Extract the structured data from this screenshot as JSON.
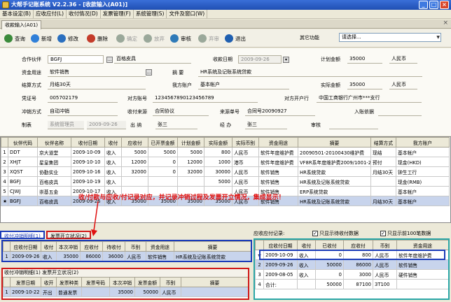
{
  "window": {
    "title": "大帮手记账系统  V2.2.36  - [收款输入(A01)]",
    "min": "_",
    "max": "□",
    "close": "×"
  },
  "menu": [
    "基本设定(B)",
    "应收应付(L)",
    "收付情况(D)",
    "发票管理(F)",
    "系统管理(S)",
    "文件及窗口(W)"
  ],
  "doc_tab": {
    "label": "收款输入(A01)",
    "close": "×"
  },
  "toolbar": {
    "buttons": [
      {
        "label": "查询",
        "color": "#3a8a3a"
      },
      {
        "label": "新增",
        "color": "#2f7fd8"
      },
      {
        "label": "修改",
        "color": "#2a6fbf"
      },
      {
        "label": "删除",
        "color": "#c43b2a"
      },
      {
        "label": "确定",
        "color": "#9aa89a"
      },
      {
        "label": "放弃",
        "color": "#9aa89a"
      },
      {
        "label": "审核",
        "color": "#2e7ab8"
      },
      {
        "label": "弃审",
        "color": "#9aa89a"
      },
      {
        "label": "退出",
        "color": "#1f5fb0"
      }
    ],
    "other_label": "其它功能",
    "other_value": "请选择..."
  },
  "form": {
    "l_party": "合作伙伴",
    "party_code": "BGFJ",
    "party_name": "百格皮具",
    "l_date": "收款日期",
    "date": "2009-09-26",
    "l_plan_amt": "计划金额",
    "plan_amt": "35000",
    "plan_cur": "人民币",
    "l_purpose": "资金用途",
    "purpose": "软件销售",
    "l_summary": "摘    要",
    "summary": "HR系统及记账系统贷款",
    "l_settle": "结算方式",
    "settle": "月结30天",
    "l_our_acc": "我方账户",
    "our_acc": "基本帐户",
    "l_act_amt": "实际金额",
    "act_amt": "35000",
    "act_cur": "人民币",
    "l_voucher": "凭证号",
    "voucher": "005702179",
    "l_their_acc": "对方账号",
    "their_acc": "1234567890123456789",
    "l_their_bank": "对方开户行",
    "their_bank": "中国工商银行广州市***支行",
    "l_offset": "冲销方式",
    "offset": "自动冲销",
    "l_src": "收付来源",
    "src": "合同协议",
    "l_src_no": "来源单号",
    "src_no": "合同号20090927",
    "l_inbound": "入账依据",
    "inbound": "",
    "l_maker": "制表",
    "maker": "系统管理员",
    "make_date": "2009-09-26",
    "l_cashier": "出  纳",
    "cashier": "张三",
    "l_handler": "经  办",
    "handler": "张三",
    "l_auditor": "审核",
    "auditor": ""
  },
  "main_grid": {
    "headers": [
      "",
      "伙伴代码",
      "伙伴名称",
      "收付日期",
      "收付",
      "应收付",
      "已开票金额",
      "计划金额",
      "实际金额",
      "实际币别",
      "资金用途",
      "摘要",
      "结算方式",
      "我方账户"
    ],
    "rows": [
      [
        "1",
        "DDT",
        "京大道堂",
        "2009-10-09",
        "收入",
        "5000",
        "5000",
        "5000",
        "800",
        "人民币",
        "软件年度维护费",
        "20090501-20100430维护费",
        "现结",
        "基本帐户"
      ],
      [
        "2",
        "XHJT",
        "星皇集团",
        "2009-10-10",
        "收入",
        "12000",
        "0",
        "12000",
        "1000",
        "港币",
        "软件年度维护费",
        "VF8R系年度维护费2009/1001-20100930",
        "预付",
        "现金(HKD)"
      ],
      [
        "3",
        "XQST",
        "协勤实业",
        "2009-10-16",
        "收入",
        "32000",
        "0",
        "32000",
        "30000",
        "人民币",
        "软件销售",
        "HR系统贷款",
        "月结30天",
        "钟生工行"
      ],
      [
        "4",
        "BGFJ",
        "百格皮具",
        "2009-10-19",
        "收入",
        "",
        "",
        "",
        "5000",
        "人民币",
        "软件销售",
        "HR系统及记账系统贷款",
        "",
        "现金(RMB)"
      ],
      [
        "5",
        "CJWJ",
        "崇基五金",
        "2009-10-17",
        "收入",
        "",
        "",
        "",
        "",
        "人民币",
        "软件销售",
        "ERP系统贷款",
        "",
        "基本帐户"
      ],
      [
        "★",
        "BGFJ",
        "百格皮具",
        "2009-09-26",
        "收入",
        "35000",
        "35000",
        "35000",
        "35000",
        "人民币",
        "软件销售",
        "HR系统及记账系统贷款",
        "月结30天",
        "基本帐户"
      ]
    ]
  },
  "annotation": "收/付款与应收/付记录对应，并记录冲销过程及发票开立情况，集成显示！",
  "bottom_tabs": [
    "收付冲销明细(1)",
    "发票开立状况(2)"
  ],
  "offset_grid": {
    "headers": [
      "",
      "应收付日期",
      "收付",
      "本次冲销",
      "应收付",
      "待收付",
      "币别",
      "资金用途",
      "摘要"
    ],
    "rows": [
      [
        "1",
        "2009-09-26",
        "收入",
        "35000",
        "86000",
        "36000",
        "人民币",
        "软件销售",
        "HR系统及记账系统贷款"
      ]
    ]
  },
  "invoice_section": {
    "title": "收付冲销明细(1)  发票开立状况(2)",
    "headers": [
      "",
      "发票日期",
      "收开",
      "发票种类",
      "发票号码",
      "本次冲销",
      "发票金额",
      "币别",
      "摘要"
    ],
    "rows": [
      [
        "1",
        "2009-10-22",
        "开出",
        "普通发票",
        "",
        "35000",
        "50000",
        "人民币",
        ""
      ]
    ]
  },
  "ar_section": {
    "title": "应收应付记录:",
    "chk1": "只显示待收付数据",
    "chk2": "只显示前100笔数据",
    "headers": [
      "",
      "应收付日期",
      "收付",
      "已收付",
      "应收付",
      "币别",
      "资金用途"
    ],
    "rows": [
      [
        "★",
        "2009-10-09",
        "收入",
        "0",
        "800",
        "人民币",
        "软件年度维护费"
      ],
      [
        "2",
        "2009-09-26",
        "收入",
        "50000",
        "86000",
        "人民币",
        "软件销售"
      ],
      [
        "3",
        "2009-08-05",
        "收入",
        "0",
        "3000",
        "人民币",
        "硬件销售"
      ],
      [
        "4",
        "合计:",
        "",
        "50000",
        "87100",
        "3T100",
        ""
      ]
    ]
  }
}
